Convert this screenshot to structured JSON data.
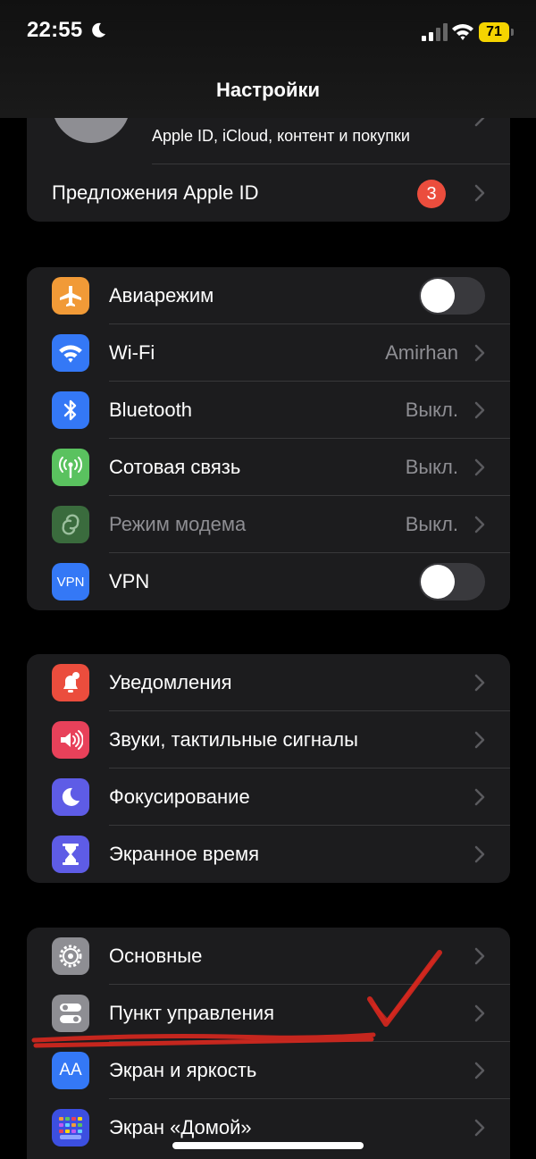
{
  "status_bar": {
    "time": "22:55",
    "battery": "71"
  },
  "header": {
    "title": "Настройки"
  },
  "apple_id": {
    "subtitle": "Apple ID, iCloud, контент и покупки",
    "suggestions_label": "Предложения Apple ID",
    "badge_count": "3"
  },
  "connectivity": [
    {
      "label": "Авиарежим",
      "type": "toggle",
      "on": false,
      "icon": "airplane-icon",
      "color": "#f19a37"
    },
    {
      "label": "Wi‑Fi",
      "value": "Amirhan",
      "icon": "wifi-icon",
      "color": "#3478f6"
    },
    {
      "label": "Bluetooth",
      "value": "Выкл.",
      "icon": "bluetooth-icon",
      "color": "#3478f6"
    },
    {
      "label": "Сотовая связь",
      "value": "Выкл.",
      "icon": "cellular-icon",
      "color": "#5ac25f"
    },
    {
      "label": "Режим модема",
      "value": "Выкл.",
      "icon": "hotspot-icon",
      "color": "#3a6b3d",
      "dimmed": true
    },
    {
      "label": "VPN",
      "type": "toggle",
      "on": false,
      "icon": "vpn-icon",
      "icon_text": "VPN",
      "color": "#3478f6"
    }
  ],
  "notifications": [
    {
      "label": "Уведомления",
      "icon": "notifications-icon",
      "color": "#eb4d3d"
    },
    {
      "label": "Звуки, тактильные сигналы",
      "icon": "sounds-icon",
      "color": "#e8415a"
    },
    {
      "label": "Фокусирование",
      "icon": "focus-moon-icon",
      "color": "#5e5ce6"
    },
    {
      "label": "Экранное время",
      "icon": "hourglass-icon",
      "color": "#5e5ce6"
    }
  ],
  "general": [
    {
      "label": "Основные",
      "icon": "gear-icon",
      "color": "#8e8e93"
    },
    {
      "label": "Пункт управления",
      "icon": "control-center-icon",
      "color": "#8e8e93"
    },
    {
      "label": "Экран и яркость",
      "icon": "display-icon",
      "icon_text": "AA",
      "color": "#3478f6"
    },
    {
      "label": "Экран «Домой»",
      "icon": "home-screen-icon",
      "color": "#3c4fe0"
    }
  ],
  "annotation": {
    "color": "#d8281e"
  }
}
